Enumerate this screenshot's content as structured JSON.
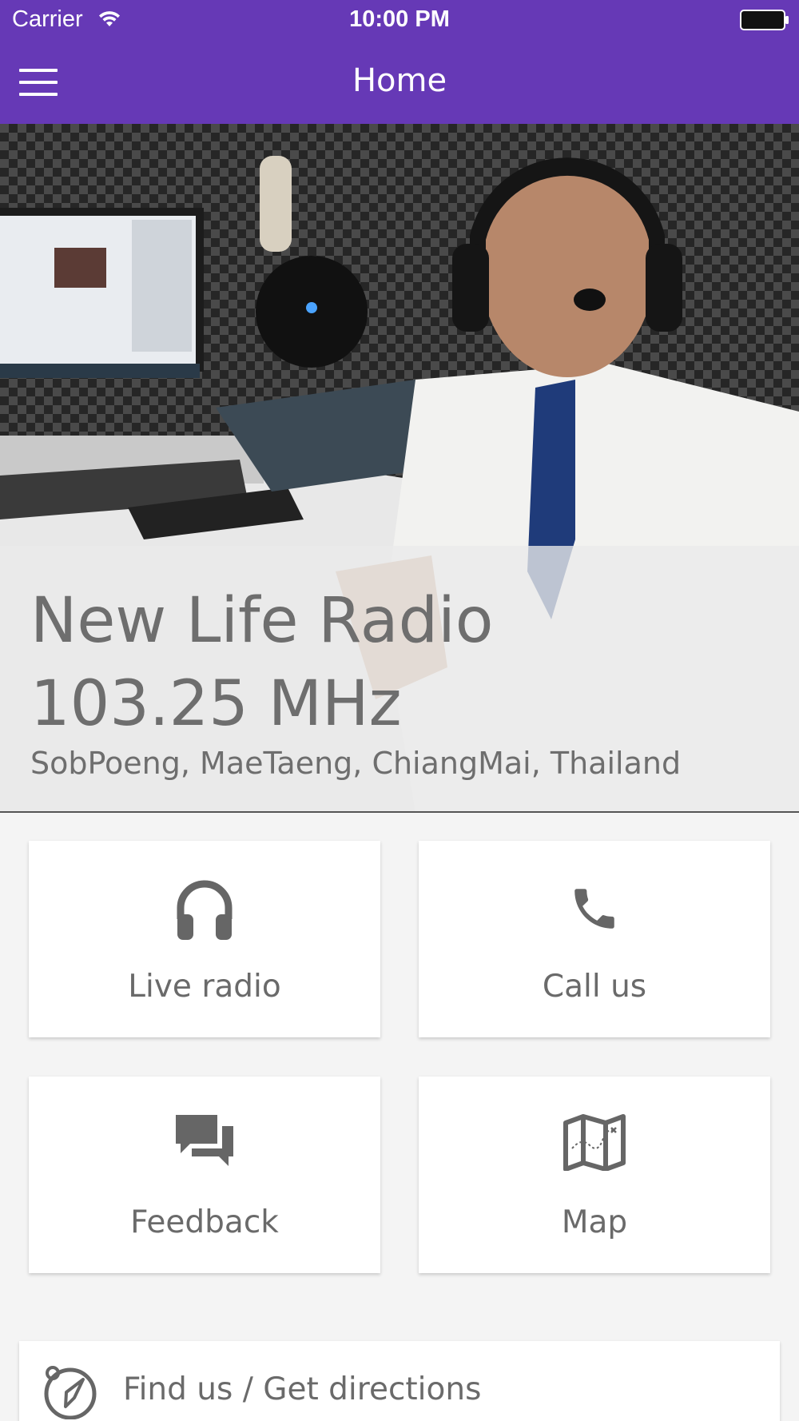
{
  "status_bar": {
    "carrier": "Carrier",
    "time": "10:00 PM",
    "wifi_icon": "wifi-icon",
    "battery_icon": "battery-icon"
  },
  "nav": {
    "title": "Home",
    "menu_icon": "hamburger-menu-icon"
  },
  "hero": {
    "title_line1": "New Life Radio",
    "title_line2": "103.25 MHz",
    "subtitle": "SobPoeng, MaeTaeng, ChiangMai, Thailand",
    "image": "radio-studio-photo"
  },
  "tiles": [
    {
      "label": "Live radio",
      "icon": "headphones-icon"
    },
    {
      "label": "Call us",
      "icon": "phone-icon"
    },
    {
      "label": "Feedback",
      "icon": "chat-bubbles-icon"
    },
    {
      "label": "Map",
      "icon": "map-icon"
    }
  ],
  "directions": {
    "label": "Find us / Get directions",
    "icon": "compass-icon"
  },
  "colors": {
    "brand": "#6639b6",
    "tile_text": "#6a6a6a",
    "background": "#f4f4f4"
  }
}
